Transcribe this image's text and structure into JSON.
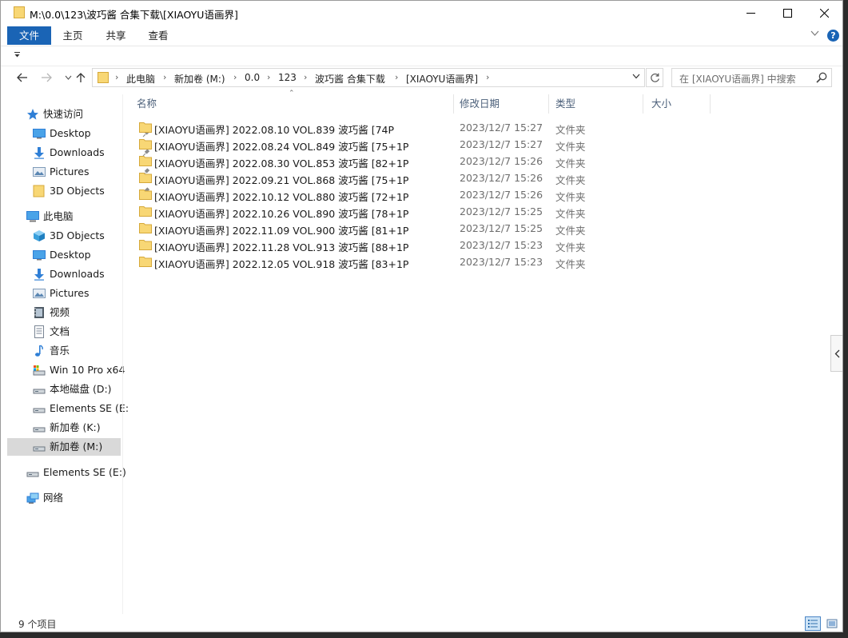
{
  "window": {
    "title": "M:\\0.0\\123\\波巧酱 合集下载\\[XIAOYU语画界]"
  },
  "ribbon": {
    "tabs": [
      "文件",
      "主页",
      "共享",
      "查看"
    ]
  },
  "address": {
    "crumbs": [
      "此电脑",
      "新加卷 (M:)",
      "0.0",
      "123",
      "波巧酱 合集下载",
      "[XIAOYU语画界]"
    ]
  },
  "search": {
    "placeholder": "在 [XIAOYU语画界] 中搜索"
  },
  "nav": {
    "quick_access": "快速访问",
    "quick_items": [
      "Desktop",
      "Downloads",
      "Pictures",
      "3D Objects"
    ],
    "this_pc": "此电脑",
    "pc_items": [
      "3D Objects",
      "Desktop",
      "Downloads",
      "Pictures",
      "视频",
      "文档",
      "音乐",
      "Win 10 Pro x64",
      "本地磁盘 (D:)",
      "Elements SE (E:",
      "新加卷 (K:)",
      "新加卷 (M:)"
    ],
    "external": "Elements SE (E:)",
    "network": "网络"
  },
  "columns": {
    "name": "名称",
    "date": "修改日期",
    "type": "类型",
    "size": "大小"
  },
  "files": [
    {
      "name": "[XIAOYU语画界] 2022.08.10 VOL.839 波巧酱 [74P",
      "date": "2023/12/7 15:27",
      "type": "文件夹"
    },
    {
      "name": "[XIAOYU语画界] 2022.08.24 VOL.849 波巧酱 [75+1P",
      "date": "2023/12/7 15:27",
      "type": "文件夹"
    },
    {
      "name": "[XIAOYU语画界] 2022.08.30 VOL.853 波巧酱 [82+1P",
      "date": "2023/12/7 15:26",
      "type": "文件夹"
    },
    {
      "name": "[XIAOYU语画界] 2022.09.21 VOL.868 波巧酱 [75+1P",
      "date": "2023/12/7 15:26",
      "type": "文件夹"
    },
    {
      "name": "[XIAOYU语画界] 2022.10.12 VOL.880 波巧酱 [72+1P",
      "date": "2023/12/7 15:26",
      "type": "文件夹"
    },
    {
      "name": "[XIAOYU语画界] 2022.10.26 VOL.890 波巧酱 [78+1P",
      "date": "2023/12/7 15:25",
      "type": "文件夹"
    },
    {
      "name": "[XIAOYU语画界] 2022.11.09 VOL.900 波巧酱 [81+1P",
      "date": "2023/12/7 15:25",
      "type": "文件夹"
    },
    {
      "name": "[XIAOYU语画界] 2022.11.28 VOL.913 波巧酱 [88+1P",
      "date": "2023/12/7 15:23",
      "type": "文件夹"
    },
    {
      "name": "[XIAOYU语画界] 2022.12.05 VOL.918 波巧酱 [83+1P",
      "date": "2023/12/7 15:23",
      "type": "文件夹"
    }
  ],
  "status": {
    "count": "9 个项目"
  },
  "colors": {
    "accent": "#1a64b5",
    "folder": "#f8d775",
    "selection": "#d9d9d9"
  }
}
